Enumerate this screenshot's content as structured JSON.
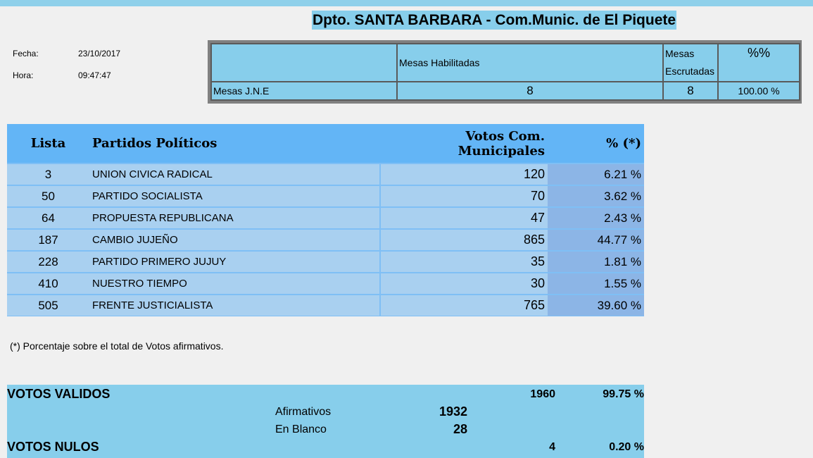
{
  "title": "Dpto. SANTA BARBARA - Com.Munic. de El Piquete",
  "meta": {
    "fecha_label": "Fecha:",
    "fecha_value": "23/10/2017",
    "hora_label": "Hora:",
    "hora_value": "09:47:47"
  },
  "mesas": {
    "header_habilitadas": "Mesas Habilitadas",
    "header_escrutadas": "Mesas Escrutadas",
    "header_pct": "%%",
    "row_label": "Mesas J.N.E",
    "habilitadas": "8",
    "escrutadas": "8",
    "pct": "100.00 %"
  },
  "partidos": {
    "headers": {
      "lista": "Lista",
      "partido": "Partidos Políticos",
      "votos": "Votos Com. Municipales",
      "pct": "% (*)"
    },
    "rows": [
      {
        "lista": "3",
        "nombre": "UNION CIVICA RADICAL",
        "votos": "120",
        "pct": "6.21 %"
      },
      {
        "lista": "50",
        "nombre": "PARTIDO SOCIALISTA",
        "votos": "70",
        "pct": "3.62 %"
      },
      {
        "lista": "64",
        "nombre": "PROPUESTA REPUBLICANA",
        "votos": "47",
        "pct": "2.43 %"
      },
      {
        "lista": "187",
        "nombre": "CAMBIO JUJEÑO",
        "votos": "865",
        "pct": "44.77 %"
      },
      {
        "lista": "228",
        "nombre": "PARTIDO PRIMERO JUJUY",
        "votos": "35",
        "pct": "1.81 %"
      },
      {
        "lista": "410",
        "nombre": "NUESTRO TIEMPO",
        "votos": "30",
        "pct": "1.55 %"
      },
      {
        "lista": "505",
        "nombre": "FRENTE JUSTICIALISTA",
        "votos": "765",
        "pct": "39.60 %"
      }
    ]
  },
  "nota": "(*) Porcentaje sobre el total de Votos afirmativos.",
  "totales": {
    "validos_label": "VOTOS VALIDOS",
    "validos_votos": "1960",
    "validos_pct": "99.75 %",
    "afirmativos_label": "Afirmativos",
    "afirmativos_votos": "1932",
    "blanco_label": "En Blanco",
    "blanco_votos": "28",
    "nulos_label": "VOTOS NULOS",
    "nulos_votos": "4",
    "nulos_pct": "0.20 %"
  }
}
